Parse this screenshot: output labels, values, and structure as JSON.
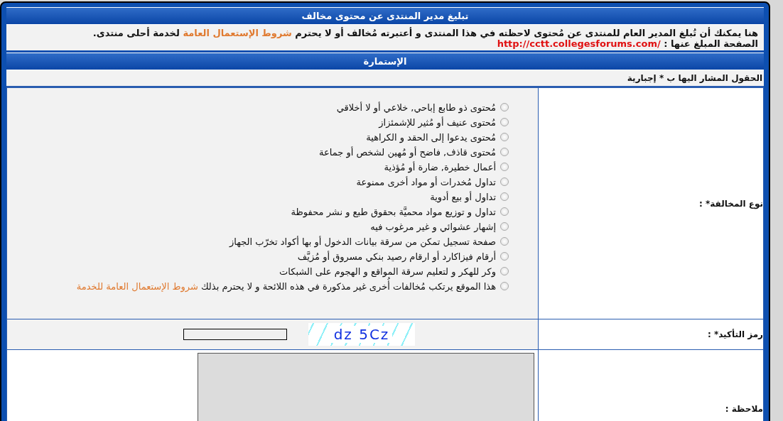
{
  "title": "تبليغ مدير المنتدى عن محتوى مخالف",
  "intro": {
    "before": "هنا يمكنك أن تُبلغ المدير العام للمنتدى عن مُحتوى لاحظته في هذا المنتدى و أعتبرته مُخالف أو لا يحترم ",
    "link": "شروط الإستعمال العامة",
    "after": " لخدمة أحلى منتدى.",
    "page_label": "الصفحة المبلغ عنها :",
    "page_url": "http://cctt.collegesforums.com/"
  },
  "form_title": "الإستمارة",
  "required_note": "الحقول المشار اليها ب * إجبارية",
  "violation": {
    "label": "نوع المخالفة* :",
    "options": [
      {
        "text": "مُحتوى ذو طابع إباحي, خلاعي أو لا أخلاقي",
        "selected": false
      },
      {
        "text": "مُحتوى عنيف أو مُثير للإشمئزاز",
        "selected": false
      },
      {
        "text": "مُحتوى يدعوا إلى الحقد و الكراهية",
        "selected": false
      },
      {
        "text": "مُحتوى قاذف, فاضح أو مُهين لشخص أو جماعة",
        "selected": false
      },
      {
        "text": "أعمال خطيرة, ضارة أو مُؤذية",
        "selected": false
      },
      {
        "text": "تداول مُخدرات أو مواد أخرى ممنوعة",
        "selected": false
      },
      {
        "text": "تداول أو بيع أدوية",
        "selected": false
      },
      {
        "text": "تداول و توزيع مواد محميَّة بحقوق طبع و نشر محفوظة",
        "selected": false
      },
      {
        "text": "إشهار عشوائي و غير مرغوب فيه",
        "selected": false
      },
      {
        "text": "صفحة تسجيل تمكن من سرقة بيانات الدخول أو بها أكواد تخرّب الجهاز",
        "selected": false
      },
      {
        "text": "أرقام فيزاكارد أو ارقام رصيد بنكي مسروق أو مُزيَّف",
        "selected": false
      },
      {
        "text": "وكر للهكر و لتعليم سرقة المواقع و الهجوم على الشبكات",
        "selected": false
      },
      {
        "text": "هذا الموقع يرتكب مُخالفات أُخرى غير مذكورة في هذه اللائحة و لا يحترم بذلك ",
        "link": "شروط الإستعمال العامة للخدمة",
        "selected": false
      }
    ]
  },
  "captcha": {
    "label": "رمز التأكيد* :",
    "code": "dz 5Cz"
  },
  "remark": {
    "label": "ملاحظة :"
  }
}
